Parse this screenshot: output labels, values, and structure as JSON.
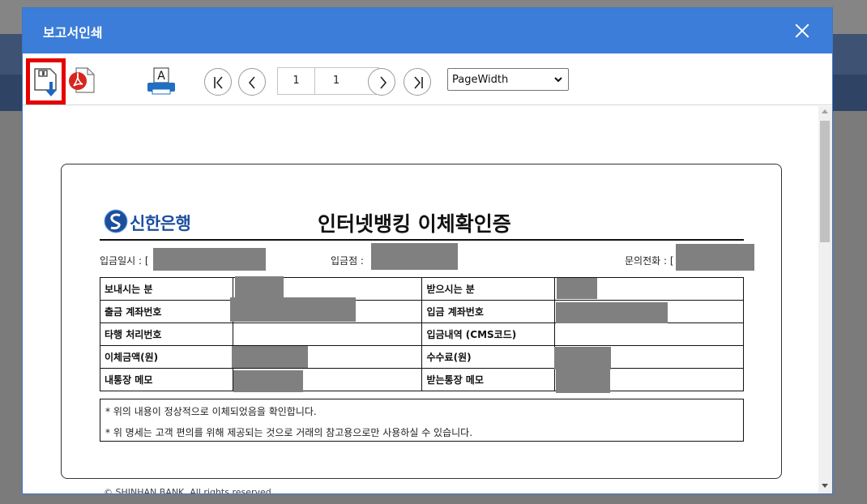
{
  "modal": {
    "title": "보고서인쇄"
  },
  "toolbar": {
    "current_page": "1",
    "total_pages": "1",
    "zoom_value": "PageWidth",
    "icons": {
      "save": "save-download-icon",
      "pdf": "pdf-icon",
      "print": "print-icon",
      "first": "first-page-icon",
      "prev": "previous-page-icon",
      "next": "next-page-icon",
      "last": "last-page-icon",
      "close": "close-icon"
    }
  },
  "document": {
    "bank_name": "신한은행",
    "title": "인터넷뱅킹 이체확인증",
    "meta": {
      "deposit_date_label": "입금일시 : [",
      "deposit_branch_label": "입금점 :",
      "contact_label": "문의전화 : ["
    },
    "table": {
      "rows": [
        {
          "left_label": "보내시는 분",
          "right_label": "받으시는 분"
        },
        {
          "left_label": "출금 계좌번호",
          "right_label": "입금 계좌번호"
        },
        {
          "left_label": "타행 처리번호",
          "right_label": "입금내역 (CMS코드)"
        },
        {
          "left_label": "이체금액(원)",
          "right_label": "수수료(원)"
        },
        {
          "left_label": "내통장 메모",
          "right_label": "받는통장 메모"
        }
      ]
    },
    "notes": [
      "* 위의 내용이 정상적으로 이체되었음을 확인합니다.",
      "* 위 명세는 고객 편의를 위해 제공되는 것으로 거래의 참고용으로만 사용하실 수 있습니다."
    ],
    "copyright": "© SHINHAN BANK. All rights reserved."
  },
  "colors": {
    "header_blue": "#3b7dd8",
    "highlight_red": "#e60000",
    "redaction_gray": "#808080",
    "brand_blue": "#1d4e9e"
  }
}
